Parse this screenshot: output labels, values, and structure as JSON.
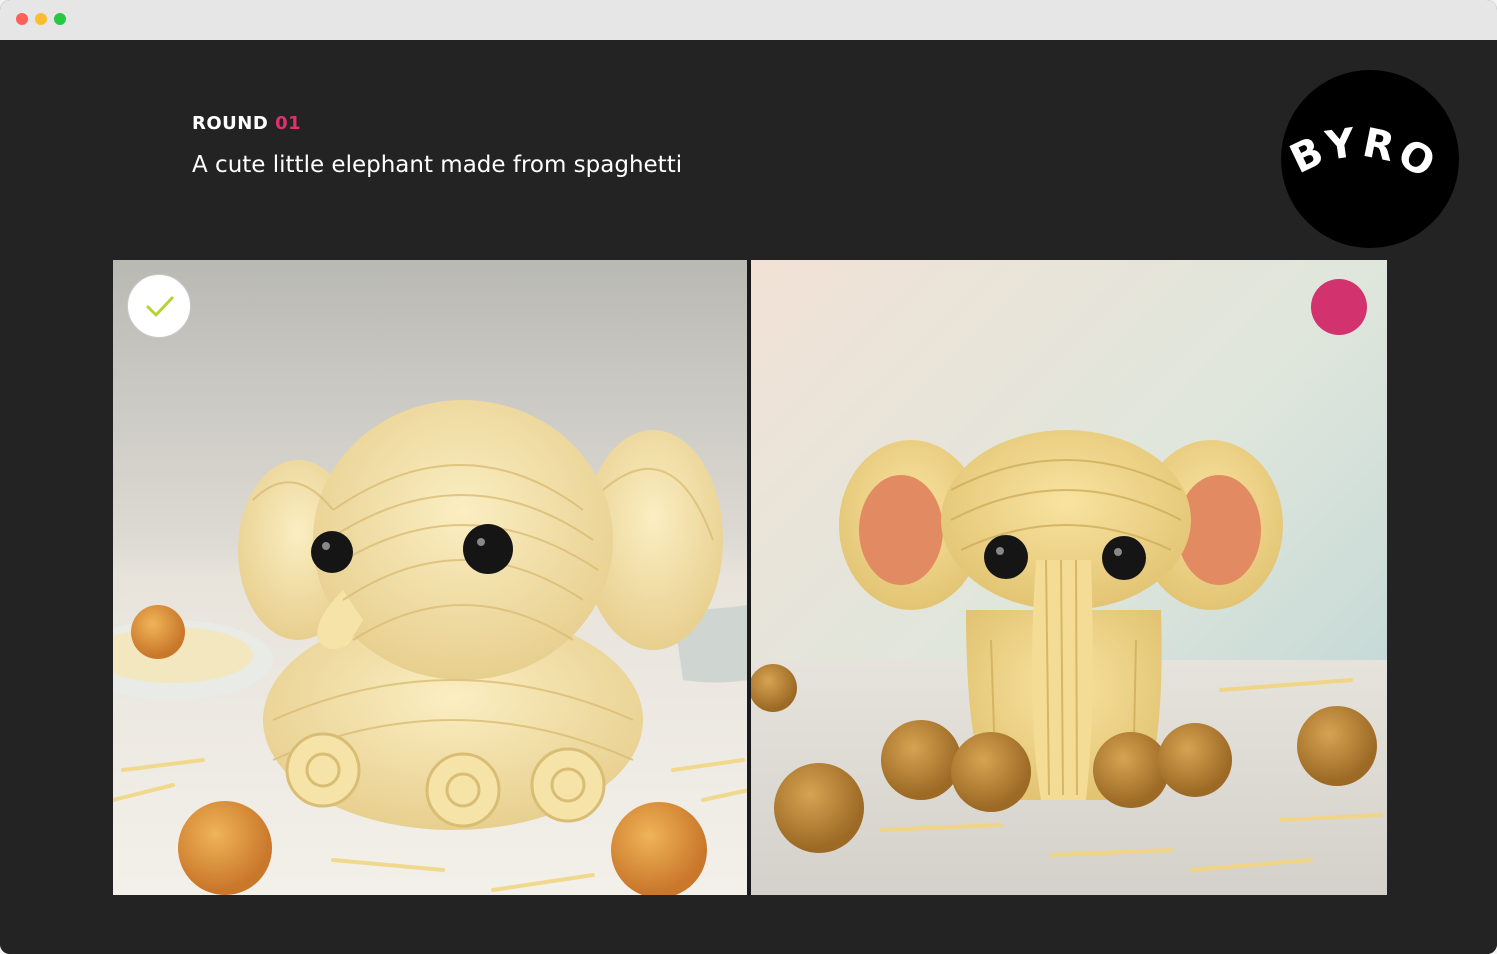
{
  "round": {
    "label": "ROUND",
    "number": "01"
  },
  "prompt": "A cute little elephant made from spaghetti",
  "logo": {
    "text": "BYRO",
    "icon": "byro-logo"
  },
  "options": [
    {
      "id": "left",
      "subject": "spaghetti-elephant-image",
      "state": "selected",
      "badge_icon": "checkmark-icon"
    },
    {
      "id": "right",
      "subject": "spaghetti-elephant-image",
      "state": "unselected",
      "badge_icon": "select-dot"
    }
  ],
  "colors": {
    "accent": "#e0306e",
    "background": "#232323",
    "check": "#b5d335",
    "select_dot": "#d2336f"
  }
}
